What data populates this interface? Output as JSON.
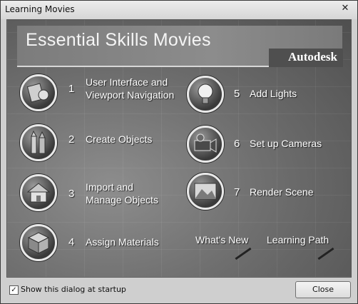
{
  "window": {
    "title": "Learning Movies",
    "close_glyph": "✕"
  },
  "header": {
    "title": "Essential Skills Movies",
    "brand": "Autodesk"
  },
  "items": [
    {
      "number": "1",
      "label_line1": "User Interface and",
      "label_line2": "Viewport Navigation",
      "icon": "viewport-icon"
    },
    {
      "number": "2",
      "label_line1": "Create Objects",
      "label_line2": "",
      "icon": "buildings-icon"
    },
    {
      "number": "3",
      "label_line1": "Import and",
      "label_line2": "Manage Objects",
      "icon": "house-icon"
    },
    {
      "number": "4",
      "label_line1": "Assign Materials",
      "label_line2": "",
      "icon": "cube-icon"
    },
    {
      "number": "5",
      "label_line1": "Add Lights",
      "label_line2": "",
      "icon": "lightbulb-icon"
    },
    {
      "number": "6",
      "label_line1": "Set up Cameras",
      "label_line2": "",
      "icon": "camera-icon"
    },
    {
      "number": "7",
      "label_line1": "Render Scene",
      "label_line2": "",
      "icon": "render-icon"
    }
  ],
  "links": {
    "whats_new": "What's New",
    "learning_path": "Learning Path"
  },
  "footer": {
    "checkbox_label": "Show this dialog at startup",
    "checkbox_checked": true,
    "checkmark": "✓",
    "close_button": "Close"
  }
}
